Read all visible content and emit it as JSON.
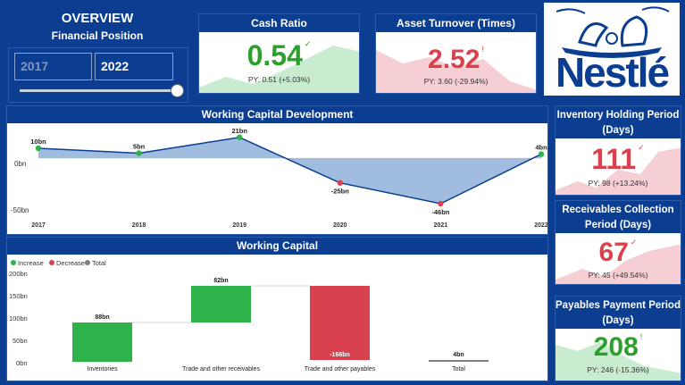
{
  "header": {
    "title": "OVERVIEW",
    "subtitle": "Financial Position"
  },
  "year_slicer": {
    "start": "2017",
    "end": "2022",
    "position": 1.0
  },
  "kpis": {
    "cash_ratio": {
      "title": "Cash Ratio",
      "value": "0.54",
      "py": "PY: 0.51 (+5.03%)",
      "mark": "✓",
      "color": "#2ca02c"
    },
    "asset_turnover": {
      "title": "Asset Turnover (Times)",
      "value": "2.52",
      "py": "PY: 3.60 (-29.94%)",
      "mark": "!",
      "color": "#d9414f"
    },
    "inventory": {
      "title": "Inventory Holding Period (Days)",
      "value": "111",
      "py": "PY: 98 (+13.24%)",
      "mark": "✓",
      "color": "#d9414f"
    },
    "receivables": {
      "title": "Receivables Collection Period (Days)",
      "value": "67",
      "py": "PY: 45 (+49.54%)",
      "mark": "✓",
      "color": "#d9414f"
    },
    "payables": {
      "title": "Payables Payment Period (Days)",
      "value": "208",
      "py": "PY: 246 (-15.36%)",
      "mark": "!",
      "color": "#2ca02c"
    }
  },
  "logo": {
    "text": "Nestlé"
  },
  "colors": {
    "brand": "#0b3d91",
    "increase": "#2db34a",
    "decrease": "#d9414f",
    "total": "#808080",
    "area": "#8fb0d8"
  },
  "chart_data": [
    {
      "type": "area",
      "title": "Working Capital Development",
      "x": [
        "2017",
        "2018",
        "2019",
        "2020",
        "2021",
        "2022"
      ],
      "values": [
        10,
        5,
        21,
        -25,
        -46,
        4
      ],
      "point_labels": [
        "10bn",
        "5bn",
        "21bn",
        "-25bn",
        "-46bn",
        "4bn"
      ],
      "point_colors": [
        "#2db34a",
        "#2db34a",
        "#2db34a",
        "#d9414f",
        "#d9414f",
        "#2db34a"
      ],
      "yticks": [
        "0bn",
        "-50bn"
      ],
      "ylim": [
        -55,
        28
      ]
    },
    {
      "type": "bar",
      "title": "Working Capital",
      "legend": [
        "Increase",
        "Decrease",
        "Total"
      ],
      "categories": [
        "Inventories",
        "Trade and other receivables",
        "Trade and other payables",
        "Total"
      ],
      "values": [
        88,
        82,
        -166,
        4
      ],
      "kinds": [
        "increase",
        "increase",
        "decrease",
        "total"
      ],
      "labels": [
        "88bn",
        "82bn",
        "-166bn",
        "4bn"
      ],
      "yticks": [
        "0bn",
        "50bn",
        "100bn",
        "150bn",
        "200bn"
      ],
      "ylim": [
        0,
        200
      ]
    }
  ]
}
